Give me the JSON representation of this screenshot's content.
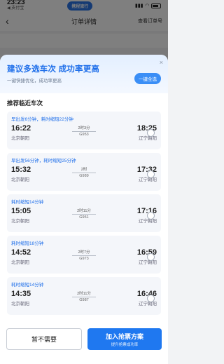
{
  "status_bar": {
    "time": "23:23",
    "back_label": "◀ 支付宝",
    "app_pill": "携程旅行",
    "battery_icon": "battery-icon"
  },
  "nav": {
    "back_icon": "‹",
    "title": "订单详情",
    "right_link": "查看订单号"
  },
  "sheet": {
    "close_icon": "×",
    "title": "建议多选车次 成功率更高",
    "subtitle": "一键快捷优化，成功率更高",
    "one_click_label": "一键全选",
    "section_title": "推荐临近车次",
    "trains": [
      {
        "note": "早出发6分钟，耗时缩短22分钟",
        "dep_time": "16:22",
        "dep_station": "北京朝阳",
        "duration": "2时3分",
        "train_no": "G953",
        "arr_time": "18:25",
        "arr_station": "辽宁朝阳"
      },
      {
        "note": "早出发56分钟，耗时缩短25分钟",
        "dep_time": "15:32",
        "dep_station": "北京朝阳",
        "duration": "2时",
        "train_no": "G989",
        "arr_time": "17:32",
        "arr_station": "辽宁朝阳"
      },
      {
        "note": "耗时缩短14分钟",
        "dep_time": "15:05",
        "dep_station": "北京朝阳",
        "duration": "2时11分",
        "train_no": "G951",
        "arr_time": "17:16",
        "arr_station": "辽宁朝阳"
      },
      {
        "note": "耗时缩短18分钟",
        "dep_time": "14:52",
        "dep_station": "北京朝阳",
        "duration": "2时7分",
        "train_no": "G973",
        "arr_time": "16:59",
        "arr_station": "辽宁朝阳"
      },
      {
        "note": "耗时缩短14分钟",
        "dep_time": "14:35",
        "dep_station": "北京朝阳",
        "duration": "2时11分",
        "train_no": "G987",
        "arr_time": "16:46",
        "arr_station": "辽宁朝阳"
      }
    ]
  },
  "footer": {
    "decline_label": "暂不需要",
    "add_label": "加入抢票方案",
    "add_sub_label": "提升抢票成功率"
  },
  "colors": {
    "accent": "#1f78f0",
    "note_blue": "#1f6fea"
  }
}
